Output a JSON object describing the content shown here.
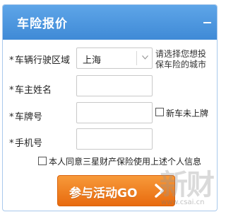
{
  "header": {
    "title": "车险报价",
    "collapse_icon": "minus-icon"
  },
  "form": {
    "region": {
      "label": "车辆行驶区域",
      "star": "*",
      "selected": "上海",
      "hint": "请选择您想投保车险的城市"
    },
    "owner_name": {
      "label": "车主姓名",
      "star": "*",
      "value": ""
    },
    "plate": {
      "label": "车牌号",
      "star": "*",
      "value": "",
      "new_car_label": "新车未上牌",
      "new_car_checked": false
    },
    "phone": {
      "label": "手机号",
      "star": "*",
      "value": ""
    },
    "agree": {
      "label": "本人同意三星财产保险使用上述个人信息",
      "checked": false
    }
  },
  "submit": {
    "label": "参与活动GO",
    "icon": "chevron-right-icon",
    "color": "#ef7d1f"
  },
  "colors": {
    "header_blue": "#4a95dd",
    "border": "#a9c9ec"
  },
  "watermark": {
    "text": "新财",
    "url": "www.csai.cn"
  }
}
